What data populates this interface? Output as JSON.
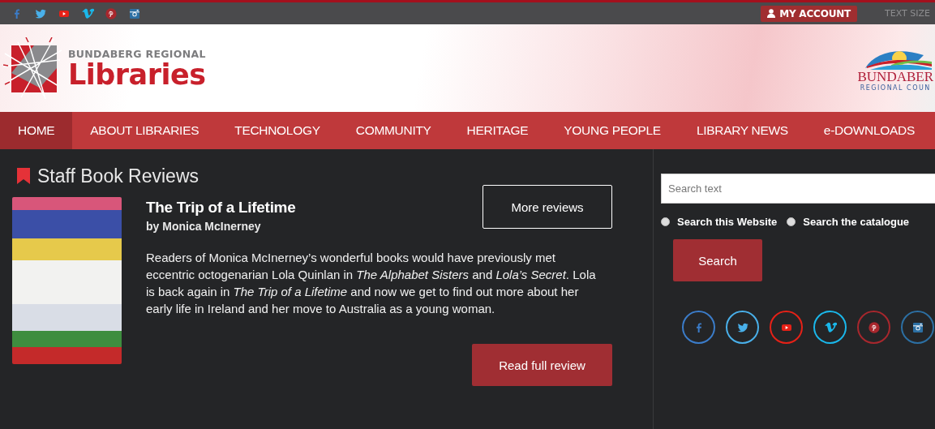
{
  "top_bar": {
    "account_button": "MY ACCOUNT",
    "text_size": "TEXT SIZE"
  },
  "header": {
    "logo_line1": "BUNDABERG REGIONAL",
    "logo_line2": "Libraries",
    "council_name": "BUNDABER",
    "council_subtitle": "REGIONAL COUN"
  },
  "nav": [
    {
      "label": "HOME",
      "selected": true
    },
    {
      "label": "ABOUT LIBRARIES",
      "selected": false
    },
    {
      "label": "TECHNOLOGY",
      "selected": false
    },
    {
      "label": "COMMUNITY",
      "selected": false
    },
    {
      "label": "HERITAGE",
      "selected": false
    },
    {
      "label": "YOUNG PEOPLE",
      "selected": false
    },
    {
      "label": "LIBRARY NEWS",
      "selected": false
    },
    {
      "label": "e-DOWNLOADS",
      "selected": false
    }
  ],
  "reviews": {
    "heading": "Staff Book Reviews",
    "more_button": "More reviews",
    "title": "The Trip of a Lifetime",
    "author": "by Monica McInerney",
    "summary": "Readers of Monica McInerney’s wonderful books would have previously met eccentric octogenarian Lola Quinlan in *The Alphabet Sisters* and *Lola’s Secret*. Lola is back again in *The Trip of a Lifetime* and now we get to find out more about her early life in Ireland and her move to Australia as a young woman.",
    "read_button": "Read full review"
  },
  "search": {
    "placeholder": "Search text",
    "options": [
      {
        "label": "Search this Website",
        "selected": false
      },
      {
        "label": "Search the catalogue",
        "selected": false
      }
    ],
    "button": "Search"
  }
}
